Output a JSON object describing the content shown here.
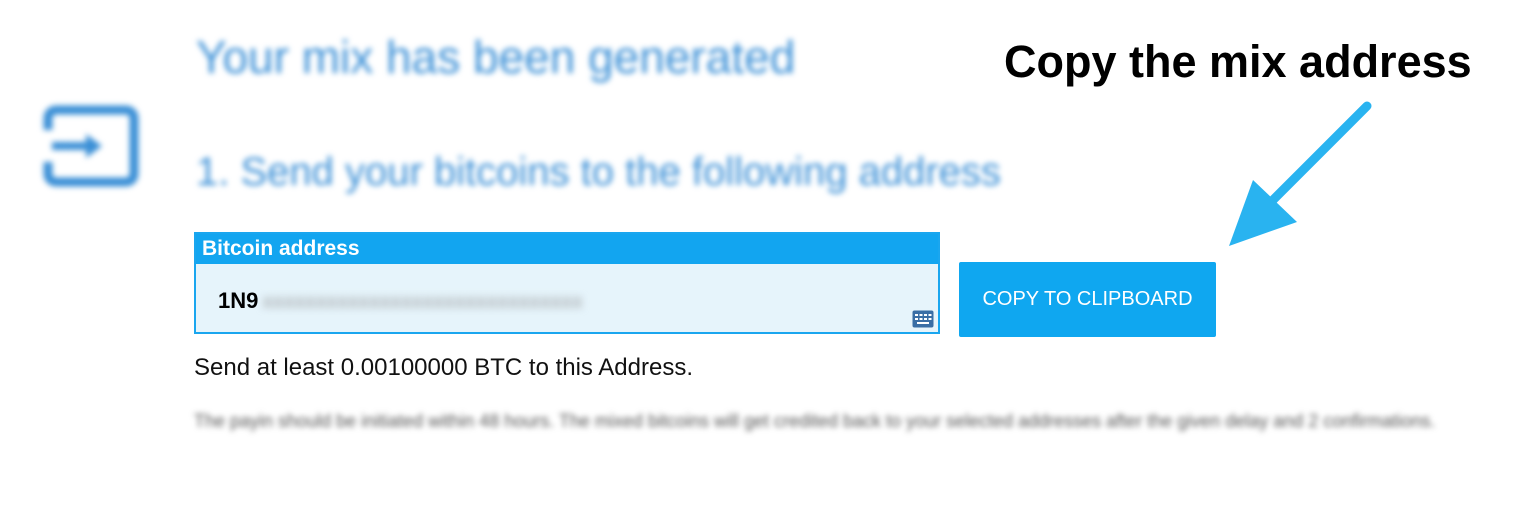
{
  "header": {
    "title": "Your mix has been generated",
    "step_title": "1. Send your bitcoins to the following address"
  },
  "address_field": {
    "label": "Bitcoin address",
    "value_visible": "1N9",
    "value_obscured": "XXXXXXXXXXXXXXXXXXXXXXXXXXXXXX"
  },
  "copy_button": {
    "label": "COPY TO CLIPBOARD"
  },
  "minimum_note": "Send at least 0.00100000 BTC to this Address.",
  "info_text": "The payin should be initiated within 48 hours. The mixed bitcoins will get credited back to your selected addresses after the given delay and 2 confirmations.",
  "annotation": {
    "text": "Copy the mix address"
  },
  "icons": {
    "enter": "enter-icon",
    "keyboard": "keyboard-icon",
    "arrow": "arrow-pointer-icon"
  },
  "colors": {
    "accent": "#0fa7f0",
    "heading": "#3a8fd6",
    "field_background": "#e6f4fb",
    "annotation_arrow": "#29b3f0"
  }
}
